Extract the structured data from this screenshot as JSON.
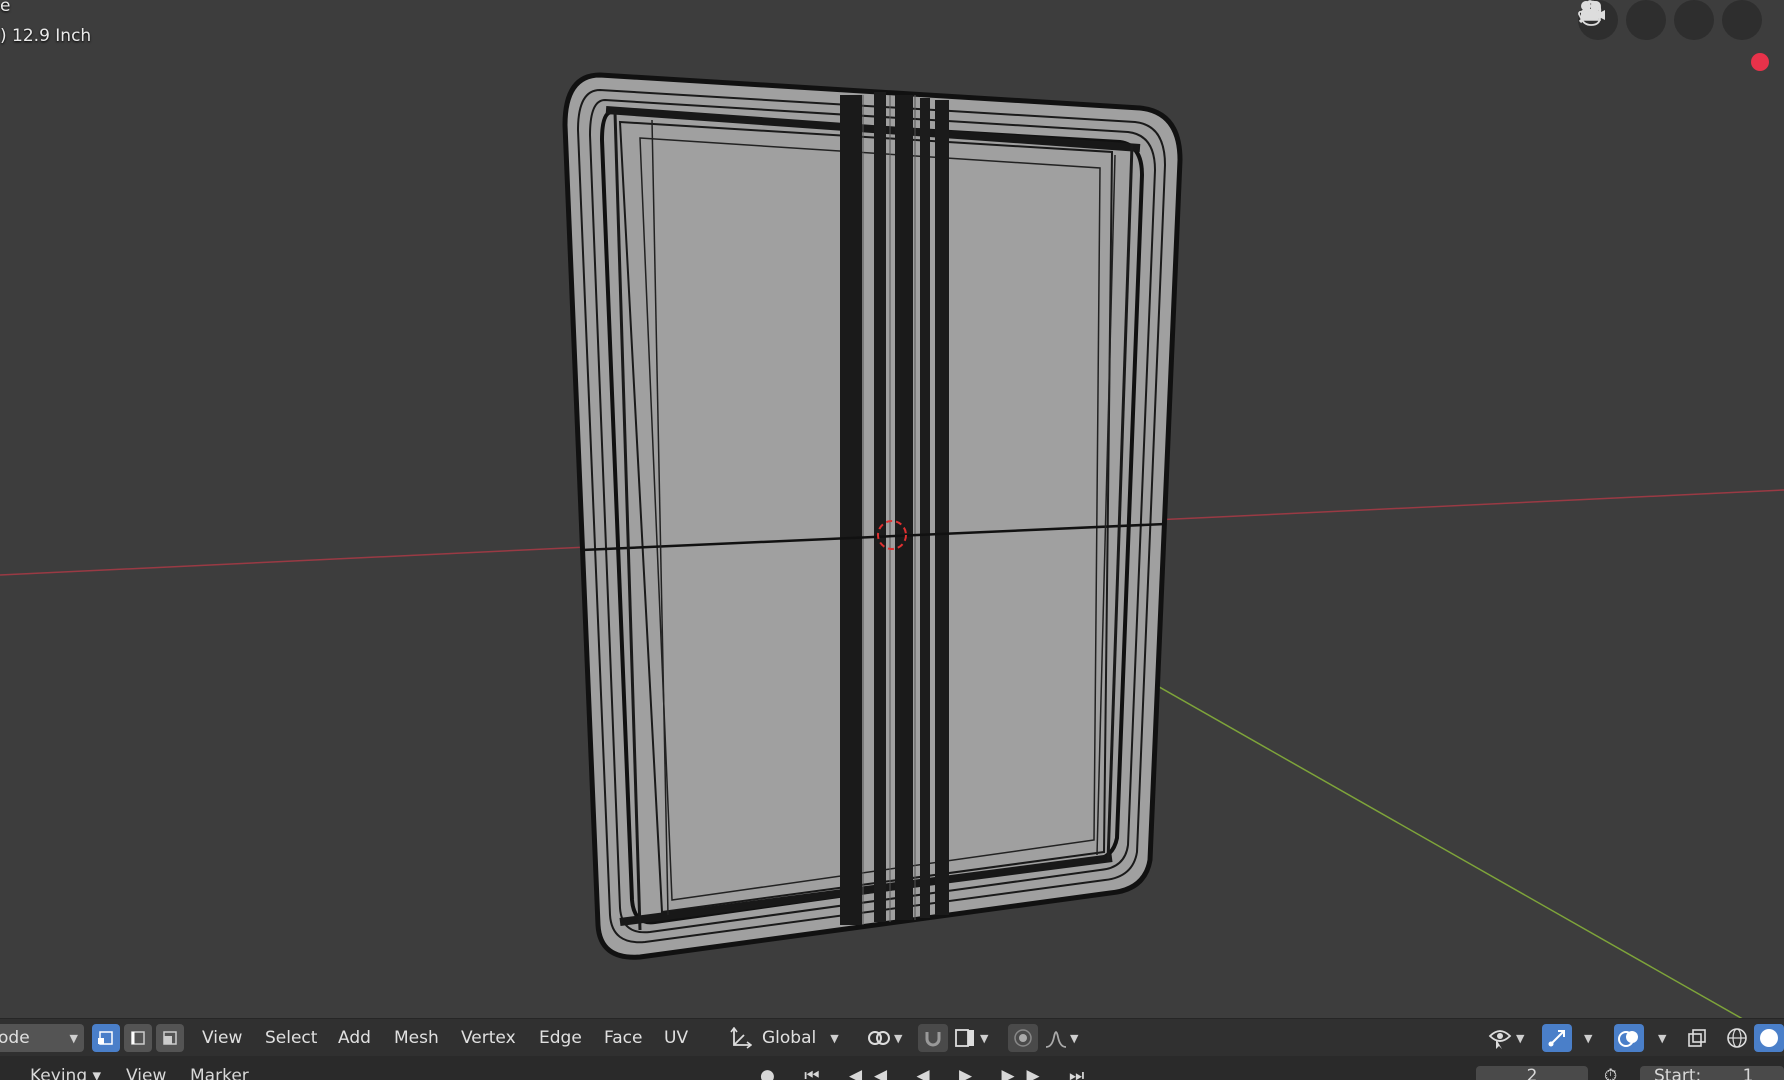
{
  "viewport": {
    "title_fragment": "e",
    "object_name": ") 12.9 Inch",
    "nav_icons": [
      "grid-icon",
      "camera-icon",
      "hand-icon",
      "zoom-icon"
    ],
    "record_color": "#e8324a",
    "x_axis_color": "#9a3a44",
    "y_axis_color": "#7ea43a"
  },
  "header": {
    "mode_label": "ode",
    "menus": [
      "View",
      "Select",
      "Add",
      "Mesh",
      "Vertex",
      "Edge",
      "Face",
      "UV"
    ],
    "orientation_label": "Global",
    "select_modes": [
      "vertex",
      "edge",
      "face"
    ],
    "active_select_mode": "vertex"
  },
  "timeline": {
    "keying_label": "Keying",
    "view_label": "View",
    "marker_label": "Marker",
    "frame_value": "2",
    "start_label": "Start:",
    "start_value": "1"
  },
  "colors": {
    "accent": "#4a7fc9",
    "viewport_bg": "#3d3d3d",
    "mesh_face": "#9e9e9e"
  }
}
